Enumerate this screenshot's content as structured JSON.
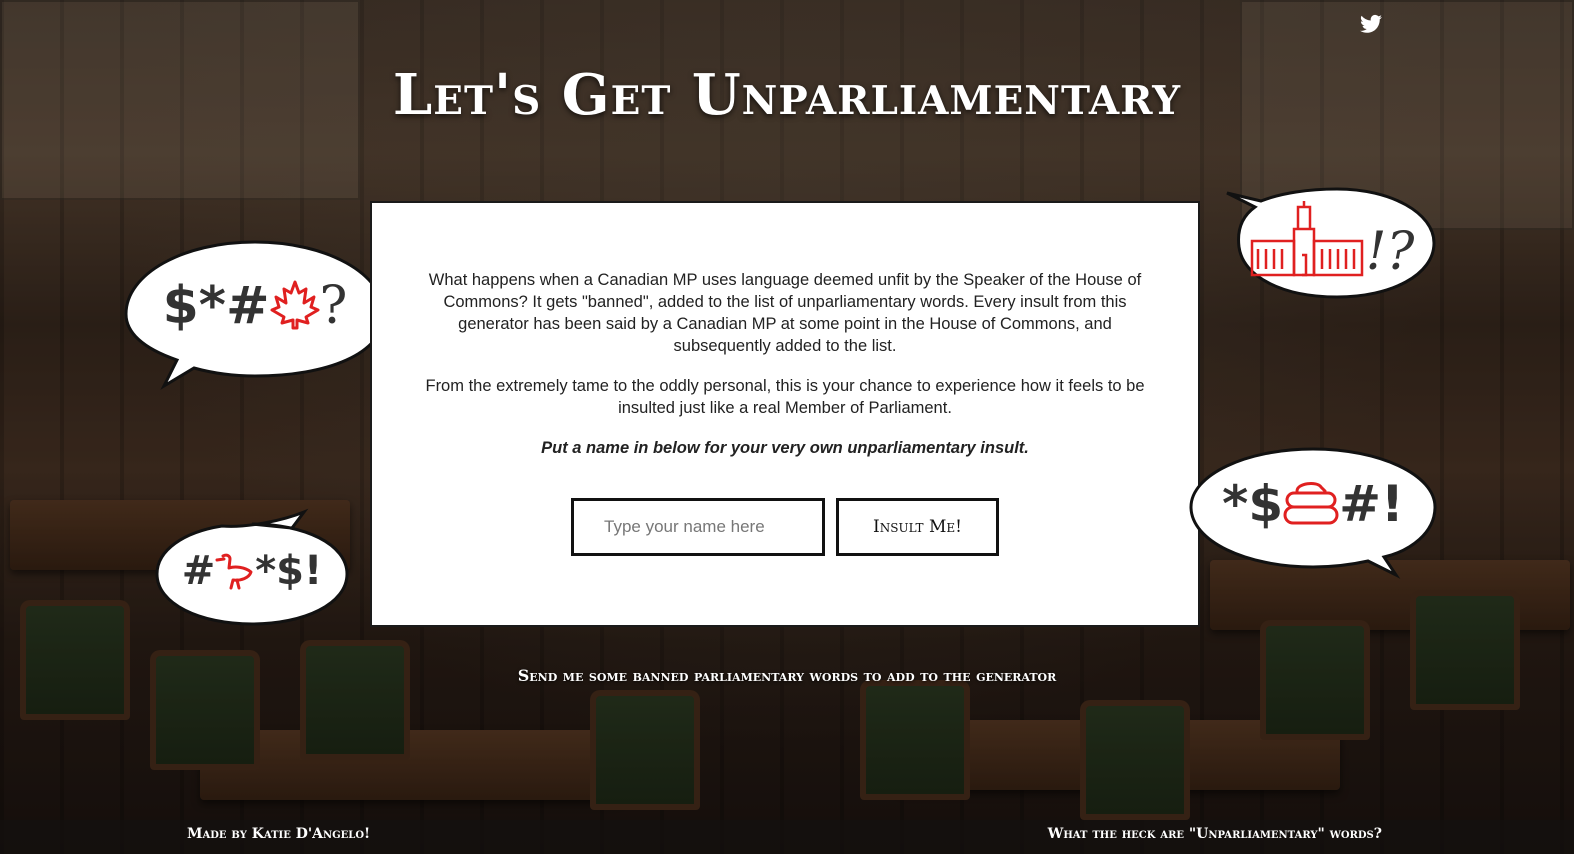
{
  "header": {
    "title": "Let's Get Unparliamentary",
    "twitter_icon": "twitter-icon"
  },
  "intro": {
    "paragraph1": "What happens when a Canadian MP uses language deemed unfit by the Speaker of the House of Commons? It gets \"banned\", added to the list of unparliamentary words. Every insult from this generator has been said by a Canadian MP at some point in the House of Commons, and subsequently added to the list.",
    "paragraph2": "From the extremely tame to the oddly personal, this is your chance to experience how it feels to be insulted just like a real Member of Parliament.",
    "prompt": "Put a name in below for your very own unparliamentary insult."
  },
  "form": {
    "name_placeholder": "Type your name here",
    "submit_label": "Insult Me!"
  },
  "bubbles": {
    "left_top": {
      "prefix": "$*#",
      "suffix": "?",
      "icon": "maple-leaf-icon"
    },
    "left_bottom": {
      "prefix": "#",
      "suffix": "*$!",
      "icon": "goose-icon"
    },
    "right_top": {
      "suffix": "!?",
      "icon": "parliament-icon"
    },
    "right_bottom": {
      "prefix": "*$",
      "suffix": "#!",
      "icon": "curling-stone-icon"
    }
  },
  "send_link": "Send me some banned parliamentary words to add to the generator",
  "footer": {
    "left": "Made by Katie D'Angelo!",
    "right": "What the heck are \"Unparliamentary\" words?"
  },
  "colors": {
    "accent_red": "#e02020",
    "card_border": "#1a1a1a"
  }
}
